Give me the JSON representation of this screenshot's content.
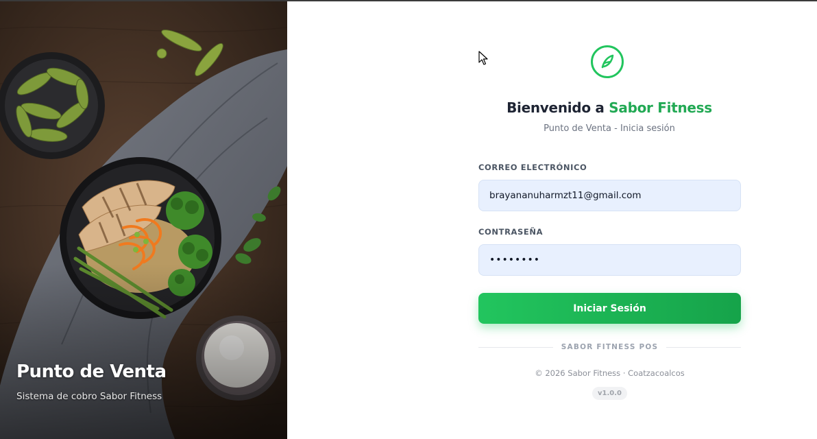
{
  "hero": {
    "title": "Punto de Venta",
    "subtitle": "Sistema de cobro Sabor Fitness"
  },
  "login": {
    "logo_icon": "leaf-icon",
    "welcome_prefix": "Bienvenido a ",
    "brand_name": "Sabor Fitness",
    "subtitle": "Punto de Venta - Inicia sesión",
    "email_label": "CORREO ELECTRÓNICO",
    "email_value": "brayananuharmzt11@gmail.com",
    "password_label": "CONTRASEÑA",
    "password_value": "••••••••",
    "submit_label": "Iniciar Sesión",
    "divider_text": "SABOR FITNESS POS",
    "copyright": "© 2026 Sabor Fitness · Coatzacoalcos",
    "version": "v1.0.0"
  },
  "colors": {
    "accent": "#22c55e",
    "accent_dark": "#16a34a",
    "brand_text": "#22a954",
    "heading": "#1e2433",
    "input_bg": "#e8f0fe"
  }
}
